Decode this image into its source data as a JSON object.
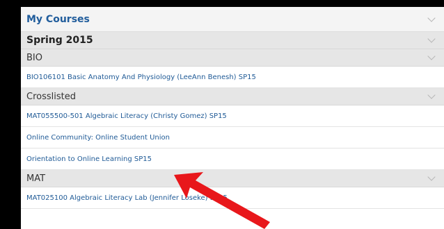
{
  "widget": {
    "title": "My Courses",
    "term": "Spring 2015",
    "groups": [
      {
        "label": "BIO",
        "courses": [
          "BIO106101 Basic Anatomy And Physiology (LeeAnn Benesh) SP15"
        ]
      },
      {
        "label": "Crosslisted",
        "courses": [
          "MAT055500-501 Algebraic Literacy (Christy Gomez) SP15",
          "Online Community: Online Student Union",
          "Orientation to Online Learning SP15"
        ]
      },
      {
        "label": "MAT",
        "courses": [
          "MAT025100 Algebraic Literacy Lab (Jennifer Loseke) SP15"
        ]
      }
    ]
  },
  "annotation": {
    "arrow_color": "#e8171b",
    "arrow_target": "Orientation to Online Learning SP15"
  },
  "colors": {
    "link": "#1f5a96",
    "title": "#215d9c"
  },
  "icons": {
    "collapse": "chevron-down-icon"
  }
}
